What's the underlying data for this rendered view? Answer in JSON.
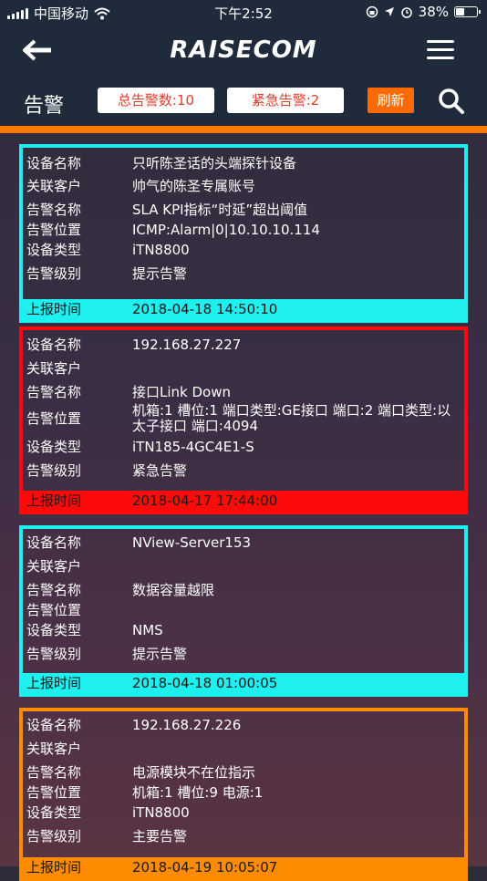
{
  "status_bar": {
    "carrier": "中国移动",
    "time": "下午2:52",
    "battery": "38%",
    "battery_level": 0.38
  },
  "nav": {
    "logo": "RAISECOM",
    "icons": [
      "back-arrow-icon",
      "hamburger-menu-icon"
    ]
  },
  "toolbar": {
    "title": "告警",
    "total_alarms": "总告警数:10",
    "urgent_alarms": "紧急告警:2",
    "refresh": "刷新",
    "search_icon": "search-icon"
  },
  "labels": {
    "device_name": "设备名称",
    "customer": "关联客户",
    "alarm_name": "告警名称",
    "alarm_location": "告警位置",
    "device_type": "设备类型",
    "alarm_level": "告警级别",
    "report_time": "上报时间"
  },
  "colors": {
    "cyan": "#1ef0f0",
    "red": "#ff0a0a",
    "orange": "#ff8c00",
    "accent": "#ff6a00"
  },
  "alarms": [
    {
      "device_name": "只听陈圣话的头端探针设备",
      "customer": "帅气的陈圣专属账号",
      "alarm_name": "SLA KPI指标“时延”超出阈值",
      "alarm_location": "ICMP:Alarm|0|10.10.10.114",
      "device_type": "iTN8800",
      "alarm_level": "提示告警",
      "report_time": "2018-04-18 14:50:10",
      "color": "#1ef0f0"
    },
    {
      "device_name": "192.168.27.227",
      "customer": "",
      "alarm_name": "接口Link Down",
      "alarm_location": "机箱:1 槽位:1 端口类型:GE接口 端口:2 端口类型:以太子接口 端口:4094",
      "device_type": "iTN185-4GC4E1-S",
      "alarm_level": "紧急告警",
      "report_time": "2018-04-17 17:44:00",
      "color": "#ff0a0a"
    },
    {
      "device_name": "NView-Server153",
      "customer": "",
      "alarm_name": "数据容量越限",
      "alarm_location": "",
      "device_type": "NMS",
      "alarm_level": "提示告警",
      "report_time": "2018-04-18 01:00:05",
      "color": "#1ef0f0"
    },
    {
      "device_name": "192.168.27.226",
      "customer": "",
      "alarm_name": "电源模块不在位指示",
      "alarm_location": "机箱:1 槽位:9 电源:1",
      "device_type": "iTN8800",
      "alarm_level": "主要告警",
      "report_time": "2018-04-19 10:05:07",
      "color": "#ff8c00"
    }
  ]
}
